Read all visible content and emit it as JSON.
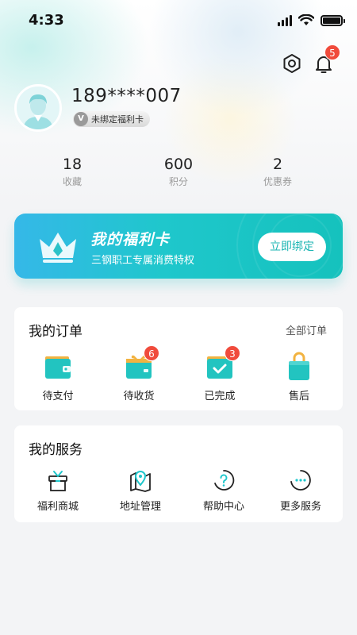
{
  "status_bar": {
    "time": "4:33"
  },
  "notifications": {
    "badge_count": "5"
  },
  "profile": {
    "phone": "189****007",
    "card_status": "未绑定福利卡",
    "tag_letter": "V"
  },
  "stats": [
    {
      "value": "18",
      "label": "收藏"
    },
    {
      "value": "600",
      "label": "积分"
    },
    {
      "value": "2",
      "label": "优惠券"
    }
  ],
  "welfare_card": {
    "title": "我的福利卡",
    "subtitle": "三钢职工专属消费特权",
    "button": "立即绑定"
  },
  "orders": {
    "title": "我的订单",
    "all_label": "全部订单",
    "items": [
      {
        "label": "待支付",
        "icon": "wallet-icon",
        "badge": ""
      },
      {
        "label": "待收货",
        "icon": "gift-box-icon",
        "badge": "6"
      },
      {
        "label": "已完成",
        "icon": "check-box-icon",
        "badge": "3"
      },
      {
        "label": "售后",
        "icon": "shopping-bag-icon",
        "badge": ""
      }
    ]
  },
  "services": {
    "title": "我的服务",
    "items": [
      {
        "label": "福利商城",
        "icon": "gift-icon"
      },
      {
        "label": "地址管理",
        "icon": "map-pin-icon"
      },
      {
        "label": "帮助中心",
        "icon": "help-icon"
      },
      {
        "label": "更多服务",
        "icon": "more-icon"
      }
    ]
  },
  "colors": {
    "accent": "#1fc7cc",
    "badge": "#f04b3c",
    "banner_start": "#35b8e8",
    "banner_end": "#15c2bd"
  }
}
